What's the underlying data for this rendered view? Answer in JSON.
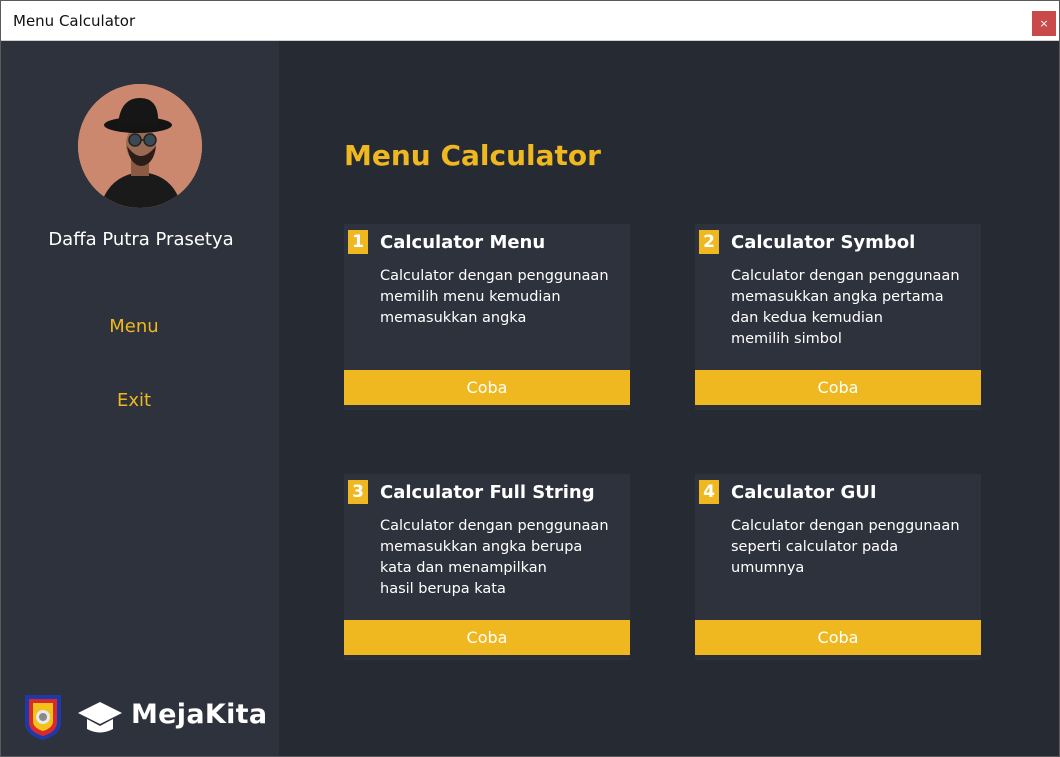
{
  "window": {
    "title": "Menu Calculator",
    "close_label": "×"
  },
  "sidebar": {
    "user_name": "Daffa Putra Prasetya",
    "nav": [
      {
        "label": "Menu"
      },
      {
        "label": "Exit"
      }
    ],
    "brand": "MejaKita"
  },
  "main": {
    "title": "Menu Calculator",
    "cards": [
      {
        "num": "1",
        "title": "Calculator Menu",
        "desc": [
          "Calculator dengan penggunaan",
          "memilih menu kemudian",
          "memasukkan angka"
        ],
        "button": "Coba"
      },
      {
        "num": "2",
        "title": "Calculator Symbol",
        "desc": [
          "Calculator dengan penggunaan",
          "memasukkan angka pertama",
          "dan kedua kemudian",
          "memilih simbol"
        ],
        "button": "Coba"
      },
      {
        "num": "3",
        "title": "Calculator Full String",
        "desc": [
          "Calculator dengan penggunaan",
          "memasukkan angka berupa",
          "kata dan menampilkan",
          "hasil berupa kata"
        ],
        "button": "Coba"
      },
      {
        "num": "4",
        "title": "Calculator GUI",
        "desc": [
          "Calculator dengan penggunaan",
          "seperti calculator pada",
          "umumnya"
        ],
        "button": "Coba"
      }
    ]
  },
  "colors": {
    "accent": "#efb820",
    "sidebar_bg": "#2e323d",
    "main_bg": "#262a33",
    "close_bg": "#c94a4a"
  },
  "icons": {
    "close": "close-icon",
    "avatar": "avatar",
    "crest": "crest-logo",
    "brand": "mejakita-logo-icon"
  }
}
